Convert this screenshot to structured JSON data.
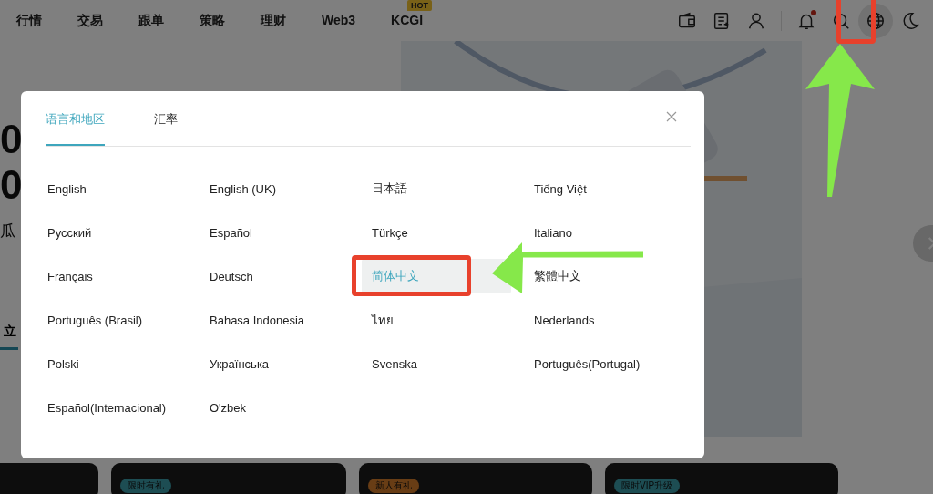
{
  "nav": {
    "items": [
      {
        "label": "行情"
      },
      {
        "label": "交易"
      },
      {
        "label": "跟单"
      },
      {
        "label": "策略"
      },
      {
        "label": "理财"
      },
      {
        "label": "Web3"
      },
      {
        "label": "KCGI",
        "badge": "HOT"
      }
    ],
    "icons": [
      {
        "kind": "wallet",
        "active": false
      },
      {
        "kind": "orders",
        "active": false
      },
      {
        "kind": "user",
        "active": false
      },
      {
        "kind": "bell",
        "active": false,
        "notification": true
      },
      {
        "kind": "search",
        "active": false
      },
      {
        "kind": "globe",
        "active": true
      },
      {
        "kind": "moon",
        "active": false
      }
    ]
  },
  "hero": {
    "texts": [
      "0",
      "0",
      "瓜",
      "立"
    ]
  },
  "modal": {
    "tabs": [
      {
        "label": "语言和地区",
        "selected": true
      },
      {
        "label": "汇率",
        "selected": false
      }
    ],
    "languages": [
      {
        "label": "English",
        "selected": false
      },
      {
        "label": "English (UK)",
        "selected": false
      },
      {
        "label": "日本語",
        "selected": false
      },
      {
        "label": "Tiếng Việt",
        "selected": false
      },
      {
        "label": "Русский",
        "selected": false
      },
      {
        "label": "Español",
        "selected": false
      },
      {
        "label": "Türkçe",
        "selected": false
      },
      {
        "label": "Italiano",
        "selected": false
      },
      {
        "label": "Français",
        "selected": false
      },
      {
        "label": "Deutsch",
        "selected": false
      },
      {
        "label": "简体中文",
        "selected": true
      },
      {
        "label": "繁體中文",
        "selected": false
      },
      {
        "label": "Português (Brasil)",
        "selected": false
      },
      {
        "label": "Bahasa Indonesia",
        "selected": false
      },
      {
        "label": "ไทย",
        "selected": false
      },
      {
        "label": "Nederlands",
        "selected": false
      },
      {
        "label": "Polski",
        "selected": false
      },
      {
        "label": "Українська",
        "selected": false
      },
      {
        "label": "Svenska",
        "selected": false
      },
      {
        "label": "Português(Portugal)",
        "selected": false
      },
      {
        "label": "Español(Internacional)",
        "selected": false
      },
      {
        "label": "O'zbek",
        "selected": false
      }
    ]
  },
  "cards": [
    {
      "kind": "plain"
    },
    {
      "kind": "badged",
      "badge": "限时有礼"
    },
    {
      "kind": "badged",
      "badge": "新人有礼"
    },
    {
      "kind": "badged",
      "badge": "限时VIP升级"
    }
  ]
}
